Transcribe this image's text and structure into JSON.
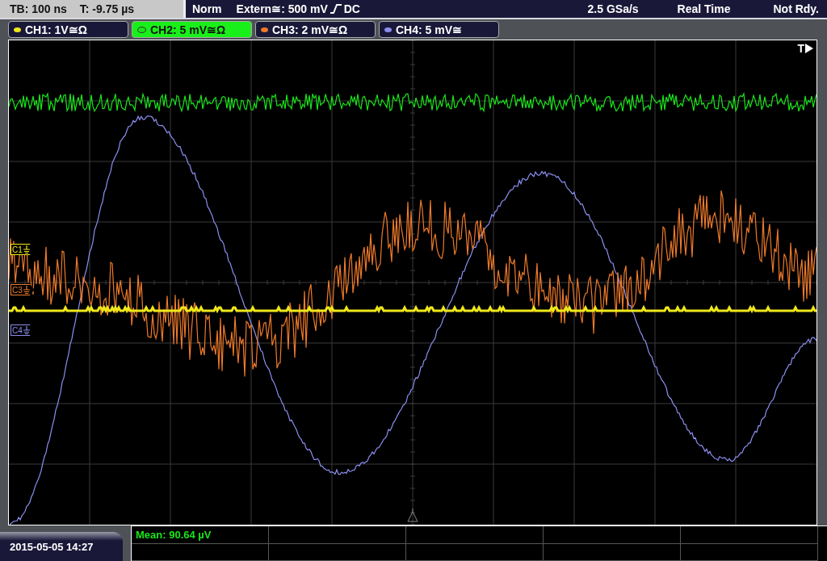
{
  "timebase": {
    "tb": "TB: 100 ns",
    "trigger_time": "T: -9.75 µs"
  },
  "trigger": {
    "mode": "Norm",
    "source": "Extern≅: 500 mV",
    "coupling": "DC"
  },
  "acquisition": {
    "sample_rate": "2.5 GSa/s",
    "mode": "Real Time",
    "status": "Not Rdy."
  },
  "channels": [
    {
      "label": "CH1: 1V≅Ω",
      "color": "#f0e81a",
      "selected": false
    },
    {
      "label": "CH2: 5 mV≅Ω",
      "color": "#19e619",
      "selected": true
    },
    {
      "label": "CH3: 2 mV≅Ω",
      "color": "#ee7a2a",
      "selected": false
    },
    {
      "label": "CH4: 5 mV≅",
      "color": "#8c8ff0",
      "selected": false
    }
  ],
  "markers": [
    {
      "label": "C1",
      "color": "#f0e81a"
    },
    {
      "label": "C3",
      "color": "#ee7a2a"
    },
    {
      "label": "C4",
      "color": "#8c8ff0"
    }
  ],
  "trigger_marker": "T",
  "date": "2015-05-05 14:27",
  "measurement": "Mean: 90.64 µV"
}
